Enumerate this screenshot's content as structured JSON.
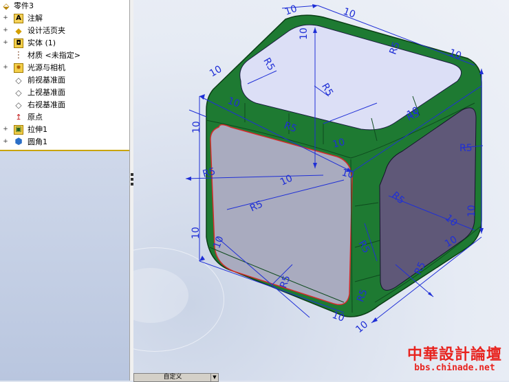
{
  "feature_tree": {
    "root": {
      "label": "零件3",
      "icon": "part-icon"
    },
    "items": [
      {
        "label": "注解",
        "icon": "annotation-icon",
        "expandable": true
      },
      {
        "label": "设计活页夹",
        "icon": "design-binder-icon",
        "expandable": true
      },
      {
        "label": "实体 (1)",
        "icon": "solid-bodies-icon",
        "expandable": true
      },
      {
        "label": "材质 <未指定>",
        "icon": "material-icon",
        "expandable": false
      },
      {
        "label": "光源与相机",
        "icon": "lights-cameras-icon",
        "expandable": true
      },
      {
        "label": "前视基准面",
        "icon": "plane-icon",
        "expandable": false
      },
      {
        "label": "上视基准面",
        "icon": "plane-icon",
        "expandable": false
      },
      {
        "label": "右视基准面",
        "icon": "plane-icon",
        "expandable": false
      },
      {
        "label": "原点",
        "icon": "origin-icon",
        "expandable": false
      },
      {
        "label": "拉伸1",
        "icon": "extrude-icon",
        "expandable": true
      },
      {
        "label": "圆角1",
        "icon": "fillet-icon",
        "expandable": true
      }
    ]
  },
  "bottom_tab": {
    "label": "自定义"
  },
  "dimensions": {
    "d10": "10",
    "r5": "R5"
  },
  "watermark": {
    "title": "中華設計論壇",
    "url": "bbs.chinade.net"
  },
  "colors": {
    "fillet_green": "#1e7a32",
    "top_face": "#dcdff6",
    "front_face": "#a9abbf",
    "right_face": "#5f5878",
    "dimension_blue": "#1f2fd6",
    "edge_red": "#d42a2a",
    "watermark_red": "#e8231e"
  }
}
